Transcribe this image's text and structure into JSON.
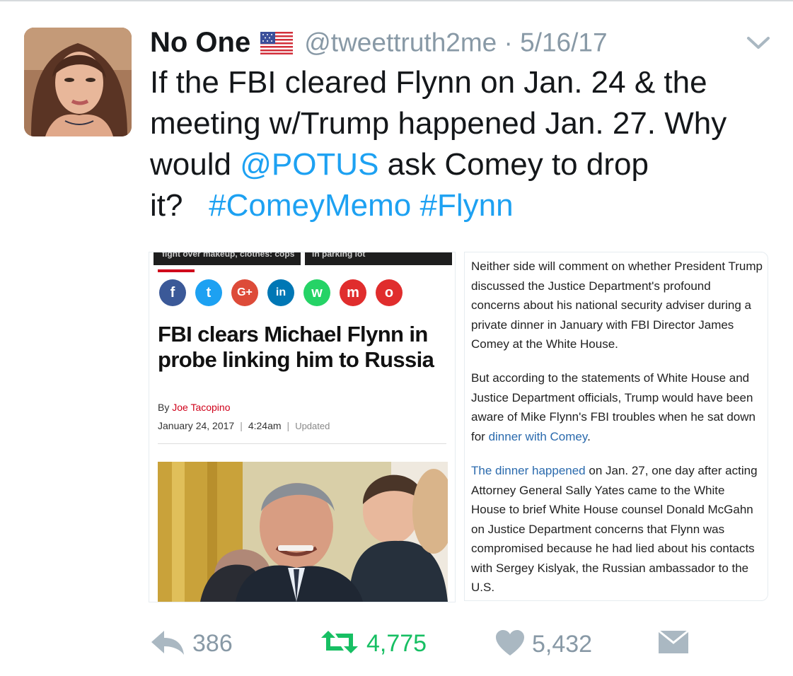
{
  "tweet": {
    "author_name": "No One",
    "handle_and_date": "@tweettruth2me · 5/16/17",
    "text_before_mention": "If the FBI cleared Flynn on Jan. 24 & the meeting w/Trump happened Jan. 27. Why would ",
    "mention": "@POTUS",
    "text_after_mention": " ask Comey to drop it?",
    "hashtag_1": "#ComeyMemo",
    "hashtag_2": "#Flynn"
  },
  "card": {
    "strip_left": "fight over makeup, clothes: cops",
    "strip_right": "in parking lot",
    "share_icons": [
      {
        "name": "facebook-share-icon",
        "glyph": "f",
        "color": "#3b5998"
      },
      {
        "name": "twitter-share-icon",
        "glyph": "t",
        "color": "#1da1f2"
      },
      {
        "name": "google-plus-share-icon",
        "glyph": "G+",
        "color": "#dd4b39"
      },
      {
        "name": "linkedin-share-icon",
        "glyph": "in",
        "color": "#0077b5"
      },
      {
        "name": "whatsapp-share-icon",
        "glyph": "w",
        "color": "#25d366"
      },
      {
        "name": "email-share-icon",
        "glyph": "m",
        "color": "#e02d2d"
      },
      {
        "name": "link-share-icon",
        "glyph": "o",
        "color": "#e02d2d"
      }
    ],
    "headline": "FBI clears Michael Flynn in probe linking him to Russia",
    "by_label": "By ",
    "author": "Joe Tacopino",
    "date": "January 24, 2017",
    "separator": "|",
    "time": "4:24am",
    "updated": "Updated",
    "para1": "Neither side will comment on whether President Trump discussed the Justice Department's profound concerns about his national security adviser during a private dinner in January with FBI Director James Comey at the White House.",
    "para2_text": "But according to the statements of White House and Justice Department officials, Trump would have been aware of Mike Flynn's FBI troubles when he sat down for ",
    "para2_link": "dinner with Comey",
    "para2_end": ".",
    "para3_link": "The dinner happened",
    "para3_text": " on Jan. 27, one day after acting Attorney General Sally Yates came to the White House to brief White House counsel Donald McGahn on Justice Department concerns that Flynn was compromised because he had lied about his contacts with Sergey Kislyak, the Russian ambassador to the U.S."
  },
  "actions": {
    "reply_count": "386",
    "retweet_count": "4,775",
    "like_count": "5,432"
  },
  "colors": {
    "link_blue": "#1da1f2",
    "retweet_green": "#17bf63",
    "muted_gray": "#8899a6"
  }
}
